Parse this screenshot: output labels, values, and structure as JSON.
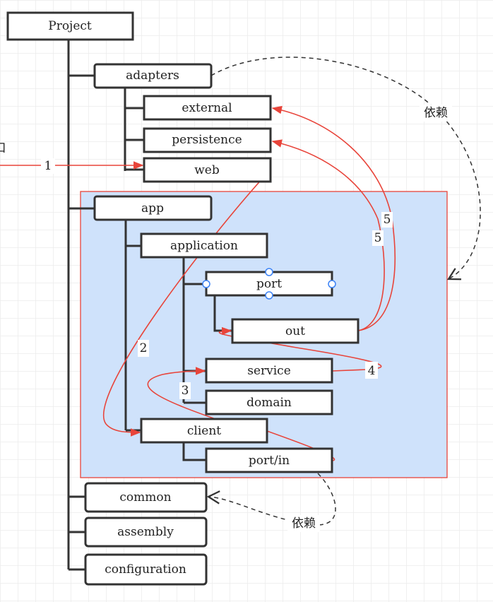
{
  "nodes": {
    "project": "Project",
    "adapters": "adapters",
    "external": "external",
    "persistence": "persistence",
    "web": "web",
    "app": "app",
    "application": "application",
    "port": "port",
    "out": "out",
    "service": "service",
    "domain": "domain",
    "client": "client",
    "port_in": "port/in",
    "common": "common",
    "assembly": "assembly",
    "configuration": "configuration"
  },
  "flow_labels": [
    "1",
    "2",
    "3",
    "4",
    "5",
    "5"
  ],
  "dependency_label": "依赖",
  "edge_text_left": "口",
  "colors": {
    "flow": "#e8443a",
    "region_fill": "#cfe2fb",
    "region_border": "#e8443a",
    "selection": "#3b82f6"
  }
}
